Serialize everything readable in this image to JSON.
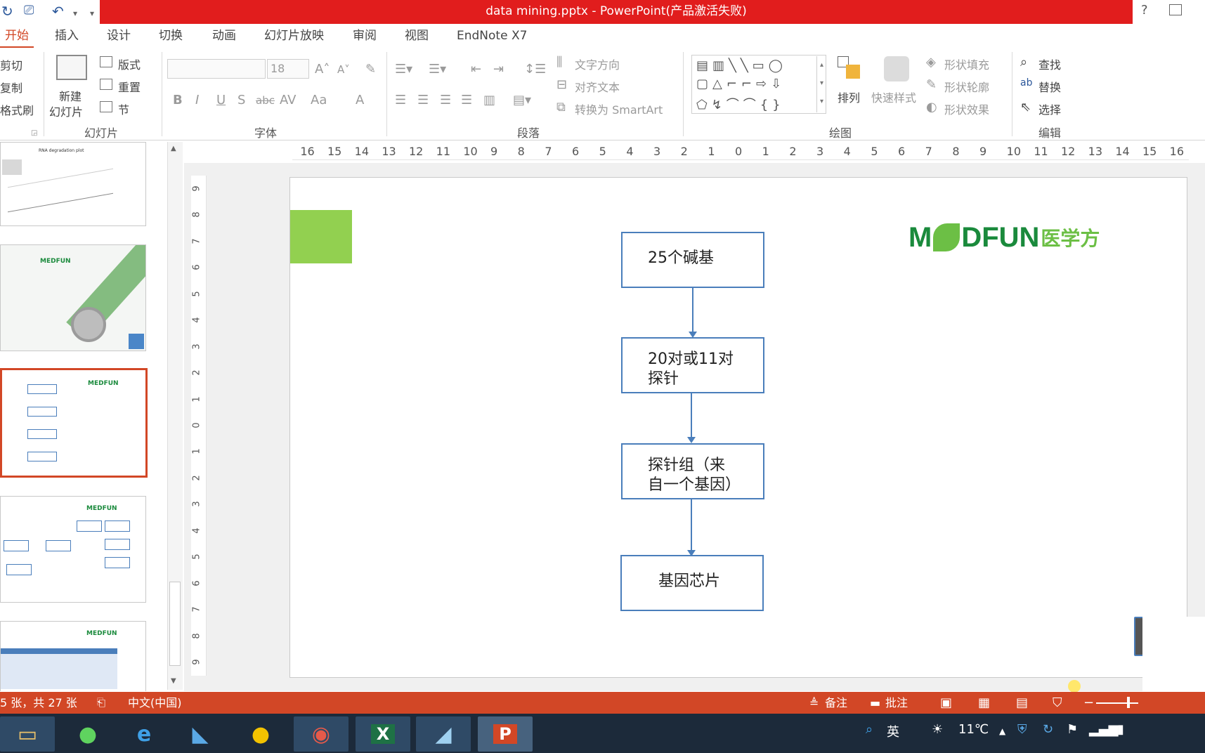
{
  "window": {
    "title": "data mining.pptx -  PowerPoint(产品激活失败)",
    "help": "?"
  },
  "tabs": [
    "开始",
    "插入",
    "设计",
    "切换",
    "动画",
    "幻灯片放映",
    "审阅",
    "视图",
    "EndNote X7"
  ],
  "ribbon": {
    "clipboard": {
      "cut": "剪切",
      "copy": "复制",
      "format_painter": "格式刷"
    },
    "slides": {
      "new_slide_line1": "新建",
      "new_slide_line2": "幻灯片",
      "layout": "版式",
      "reset": "重置",
      "section": "节",
      "group_label": "幻灯片"
    },
    "font": {
      "size": "18",
      "bold": "B",
      "italic": "I",
      "underline": "U",
      "shadow": "S",
      "strike": "abc",
      "spacing": "AV",
      "case": "Aa",
      "color": "A",
      "group_label": "字体"
    },
    "paragraph": {
      "text_direction": "文字方向",
      "align_text": "对齐文本",
      "smartart": "转换为 SmartArt",
      "group_label": "段落"
    },
    "drawing": {
      "arrange": "排列",
      "quick_styles": "快速样式",
      "shape_fill": "形状填充",
      "shape_outline": "形状轮廓",
      "shape_effects": "形状效果",
      "group_label": "绘图"
    },
    "editing": {
      "find": "查找",
      "replace": "替换",
      "select": "选择",
      "group_label": "编辑"
    }
  },
  "thumbnails": {
    "slide1_title": "RNA degradation plot",
    "logo_text": "MEDFUN"
  },
  "ruler": {
    "h_ticks": [
      "16",
      "15",
      "14",
      "13",
      "12",
      "11",
      "10",
      "9",
      "8",
      "7",
      "6",
      "5",
      "4",
      "3",
      "2",
      "1",
      "0",
      "1",
      "2",
      "3",
      "4",
      "5",
      "6",
      "7",
      "8",
      "9",
      "10",
      "11",
      "12",
      "13",
      "14",
      "15",
      "16"
    ],
    "v_ticks": [
      "9",
      "8",
      "7",
      "6",
      "5",
      "4",
      "3",
      "2",
      "1",
      "0",
      "1",
      "2",
      "3",
      "4",
      "5",
      "6",
      "7",
      "8",
      "9"
    ]
  },
  "slide": {
    "logo_main": "M",
    "logo_rest": "DFUN",
    "logo_cn": "医学方",
    "flow": [
      "25个碱基",
      "20对或11对\n探针",
      "探针组（来\n自一个基因）",
      "基因芯片"
    ]
  },
  "status": {
    "slide_info": "5 张，共 27 张",
    "language": "中文(中国)",
    "notes": "备注",
    "comments": "批注"
  },
  "taskbar": {
    "ime": "英",
    "temperature": "11℃"
  },
  "colors": {
    "accent": "#d24726",
    "title_red": "#e11d1d",
    "flow_border": "#4a7ebb",
    "logo_green": "#1a8a3c",
    "square_green": "#92d050"
  }
}
